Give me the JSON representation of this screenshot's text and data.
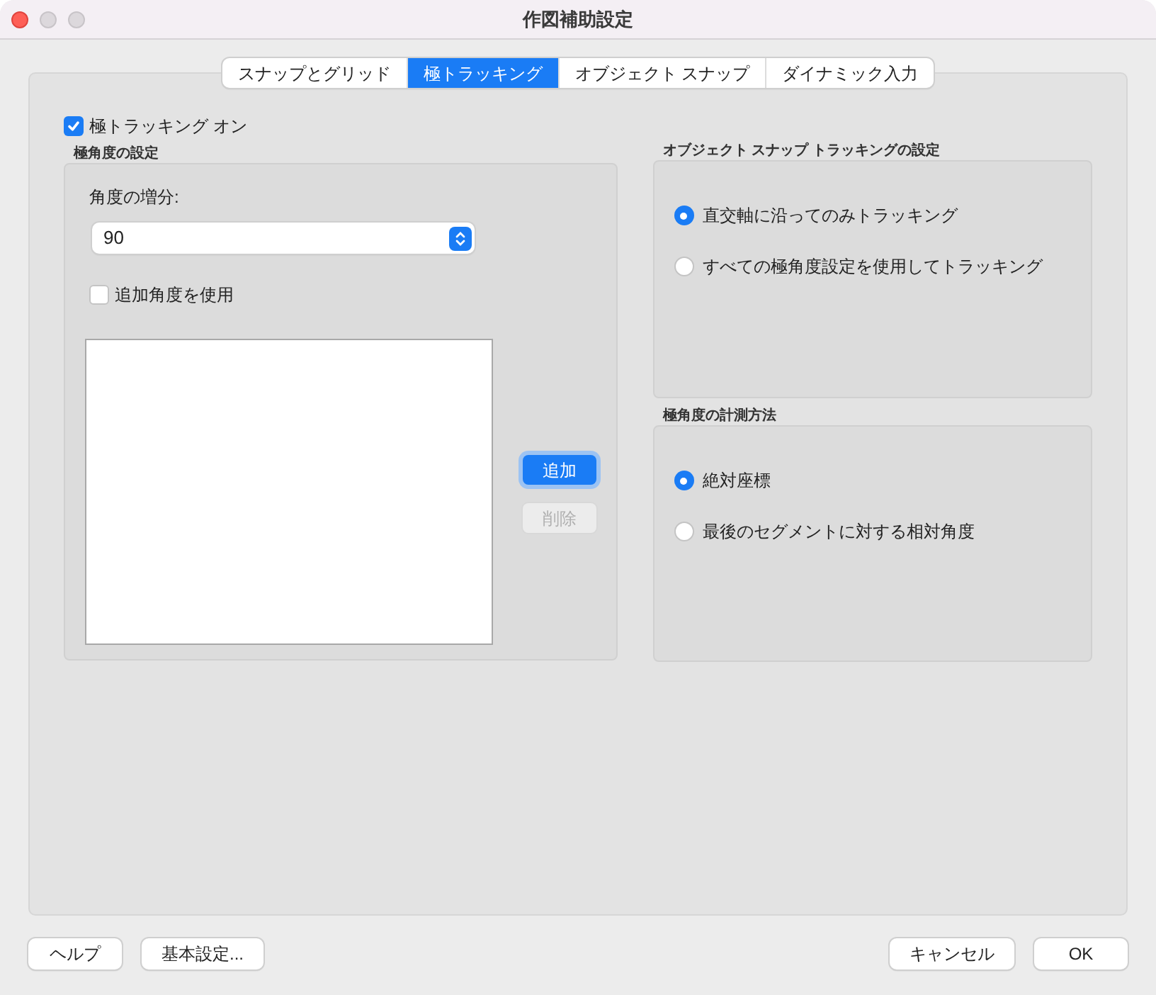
{
  "window": {
    "title": "作図補助設定"
  },
  "tabs": [
    {
      "label": "スナップとグリッド",
      "selected": false
    },
    {
      "label": "極トラッキング",
      "selected": true
    },
    {
      "label": "オブジェクト スナップ",
      "selected": false
    },
    {
      "label": "ダイナミック入力",
      "selected": false
    }
  ],
  "polar_tracking_on": {
    "label": "極トラッキング オン",
    "checked": true
  },
  "polar_settings": {
    "title": "極角度の設定",
    "increment_label": "角度の増分:",
    "increment_value": "90",
    "additional_angles": {
      "label": "追加角度を使用",
      "checked": false
    },
    "add_button": {
      "label": "追加",
      "default": true,
      "disabled": false
    },
    "delete_button": {
      "label": "削除",
      "default": false,
      "disabled": true
    }
  },
  "osnap_tracking": {
    "title": "オブジェクト スナップ トラッキングの設定",
    "options": [
      {
        "label": "直交軸に沿ってのみトラッキング",
        "selected": true
      },
      {
        "label": "すべての極角度設定を使用してトラッキング",
        "selected": false
      }
    ]
  },
  "measurement": {
    "title": "極角度の計測方法",
    "options": [
      {
        "label": "絶対座標",
        "selected": true
      },
      {
        "label": "最後のセグメントに対する相対角度",
        "selected": false
      }
    ]
  },
  "footer_left": [
    {
      "label": "ヘルプ"
    },
    {
      "label": "基本設定..."
    }
  ],
  "footer_right": [
    {
      "label": "キャンセル"
    },
    {
      "label": "OK"
    }
  ]
}
